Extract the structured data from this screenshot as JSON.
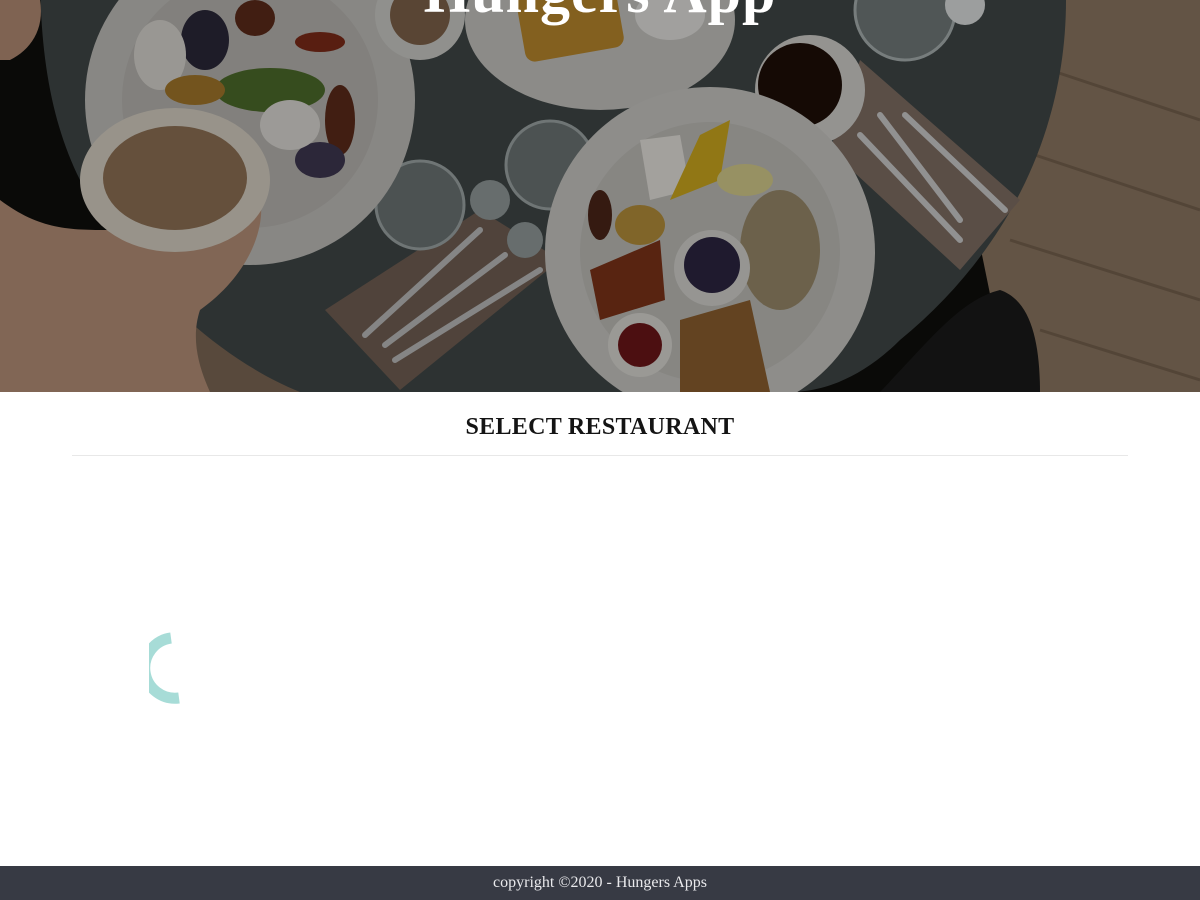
{
  "hero": {
    "title": "Hungers App",
    "image": "overhead-breakfast-table-photo"
  },
  "section": {
    "title": "SELECT RESTAURANT"
  },
  "loader": {
    "icon": "loading-spinner-icon",
    "color": "#a7dcd7"
  },
  "footer": {
    "copyright": "copyright ©2020 - Hungers Apps",
    "background": "#373a44"
  }
}
